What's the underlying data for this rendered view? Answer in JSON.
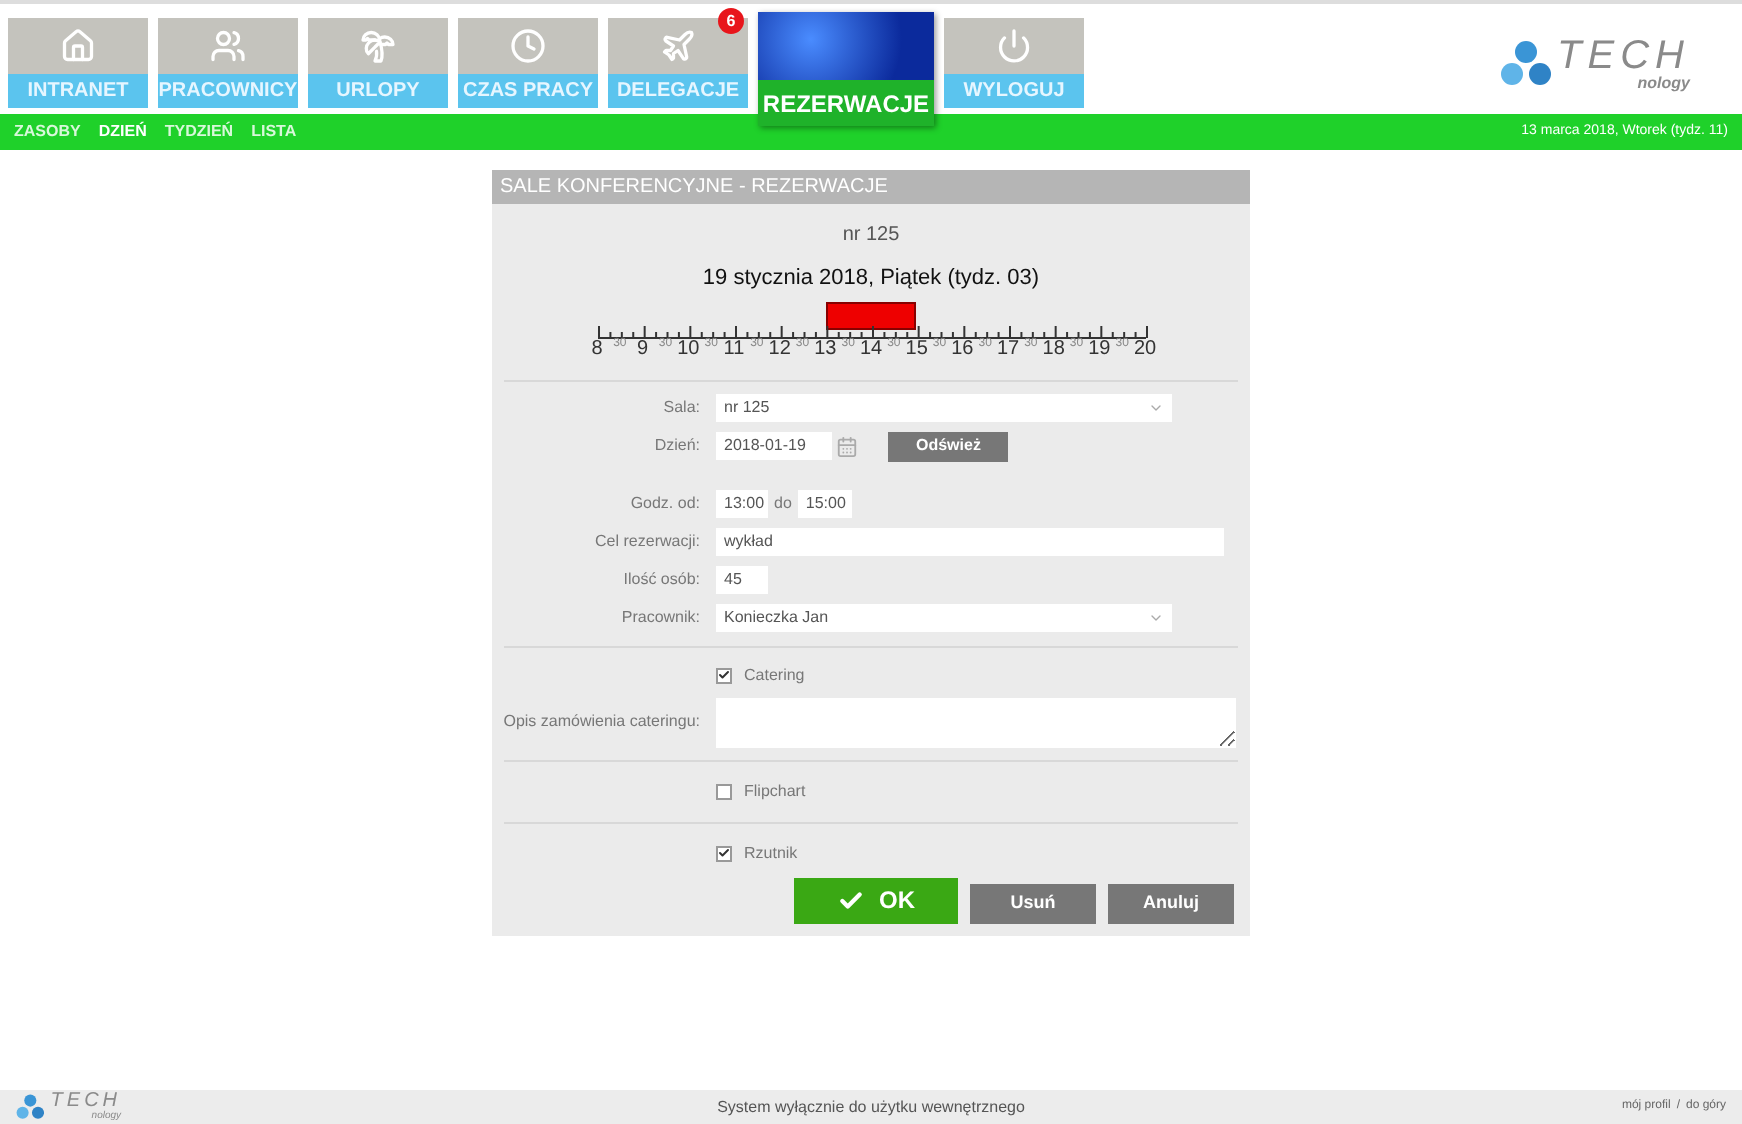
{
  "nav": [
    {
      "kind": "home",
      "label": "INTRANET",
      "selected": false
    },
    {
      "kind": "people",
      "label": "PRACOWNICY",
      "selected": false
    },
    {
      "kind": "palm",
      "label": "URLOPY",
      "selected": false
    },
    {
      "kind": "clock",
      "label": "CZAS PRACY",
      "selected": false
    },
    {
      "kind": "plane",
      "label": "DELEGACJE",
      "selected": false,
      "badge": "6"
    },
    {
      "kind": "photo",
      "label": "REZERWACJE",
      "selected": true
    },
    {
      "kind": "power",
      "label": "WYLOGUJ",
      "selected": false
    }
  ],
  "logo": {
    "word": "TECH",
    "sub": "nology"
  },
  "subnav": [
    {
      "label": "ZASOBY",
      "selected": false
    },
    {
      "label": "DZIEŃ",
      "selected": true
    },
    {
      "label": "TYDZIEŃ",
      "selected": false
    },
    {
      "label": "LISTA",
      "selected": false
    }
  ],
  "today": "13 marca 2018, Wtorek (tydz. 11)",
  "panel": {
    "title": "SALE KONFERENCYJNE - REZERWACJE",
    "room": "nr 125",
    "date_heading": "19 stycznia 2018, Piątek (tydz. 03)",
    "timeline": [
      {
        "hour": "8",
        "half": "30"
      },
      {
        "hour": "9",
        "half": "30"
      },
      {
        "hour": "10",
        "half": "30"
      },
      {
        "hour": "11",
        "half": "30"
      },
      {
        "hour": "12",
        "half": "30"
      },
      {
        "hour": "13",
        "half": "30"
      },
      {
        "hour": "14",
        "half": "30"
      },
      {
        "hour": "15",
        "half": "30"
      },
      {
        "hour": "16",
        "half": "30"
      },
      {
        "hour": "17",
        "half": "30"
      },
      {
        "hour": "18",
        "half": "30"
      },
      {
        "hour": "19",
        "half": "30"
      },
      {
        "hour": "20"
      }
    ],
    "sala": {
      "label": "Sala:",
      "value": "nr 125"
    },
    "day": {
      "label": "Dzień:",
      "value": "2018-01-19",
      "button": "Odśwież"
    },
    "hours": {
      "label": "Godz. od:",
      "from": "13:00",
      "to_label": "do",
      "to": "15:00"
    },
    "purpose": {
      "label": "Cel rezerwacji:",
      "value": "wykład"
    },
    "people": {
      "label": "Ilość osób:",
      "value": "45"
    },
    "employee": {
      "label": "Pracownik:",
      "value": "Konieczka Jan"
    },
    "catering": {
      "label": "Catering",
      "checked": true
    },
    "catering_note": {
      "label": "Opis zamówienia cateringu:"
    },
    "flipchart": {
      "label": "Flipchart",
      "checked": false
    },
    "projector": {
      "label": "Rzutnik",
      "checked": true
    },
    "buttons": {
      "ok": "OK",
      "delete": "Usuń",
      "cancel": "Anuluj"
    }
  },
  "footer": {
    "logo": {
      "word": "TECH",
      "sub": "nology"
    },
    "notice": "System wyłącznie do użytku wewnętrznego",
    "links": [
      {
        "label": "mój profil"
      },
      {
        "label": "do góry"
      }
    ],
    "separator": "/"
  }
}
